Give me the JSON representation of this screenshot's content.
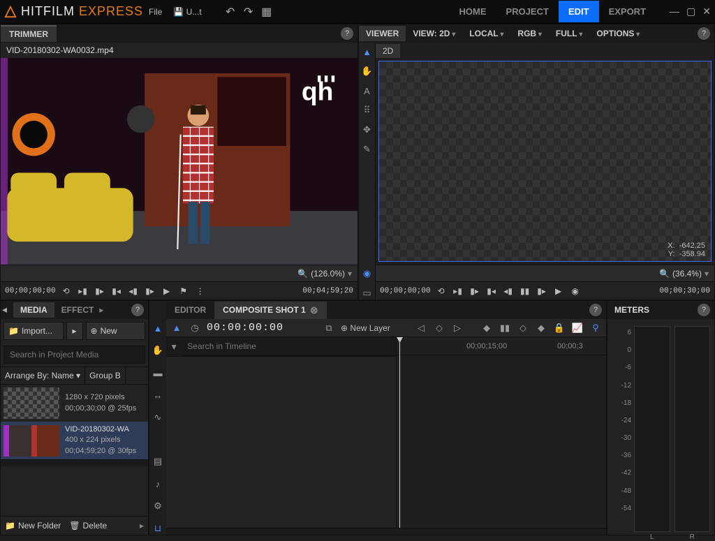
{
  "app": {
    "title_a": "HITFILM ",
    "title_b": "EXPRESS"
  },
  "menu": {
    "file": "File",
    "save": "U...t"
  },
  "nav": {
    "home": "HOME",
    "project": "PROJECT",
    "edit": "EDIT",
    "export": "EXPORT"
  },
  "trimmer": {
    "title": "TRIMMER",
    "clip": "VID-20180302-WA0032.mp4",
    "zoom": "(126.0%)",
    "tc_in": "00;00;00;00",
    "tc_out": "00;04;59;20"
  },
  "viewer": {
    "title": "VIEWER",
    "view": "VIEW: 2D",
    "space": "LOCAL",
    "channel": "RGB",
    "quality": "FULL",
    "options": "OPTIONS",
    "tab2d": "2D",
    "coord_x_label": "X:",
    "coord_x": "-642.25",
    "coord_y_label": "Y:",
    "coord_y": "-358.94",
    "zoom": "(36.4%)",
    "tc_in": "00;00;00;00",
    "tc_out": "00;00;30;00"
  },
  "media": {
    "tabs": {
      "media": "MEDIA",
      "effects": "EFFECT"
    },
    "import": "Import...",
    "new": "New",
    "search_placeholder": "Search in Project Media",
    "arrange_label": "Arrange By: Name ▾",
    "group_label": "Group B",
    "items": [
      {
        "name": "",
        "dims": "1280 x 720 pixels",
        "dur": "00;00;30;00 @ 25fps"
      },
      {
        "name": "VID-20180302-WA",
        "dims": "400 x 224 pixels",
        "dur": "00;04;59;20 @ 30fps"
      }
    ],
    "newfolder": "New Folder",
    "delete": "Delete"
  },
  "timeline": {
    "tabs": {
      "editor": "EDITOR",
      "comp": "COMPOSITE SHOT 1"
    },
    "time": "00:00:00:00",
    "newlayer": "New Layer",
    "search_placeholder": "Search in Timeline",
    "ruler_t1": "00;00;15;00",
    "ruler_t2": "00;00;3"
  },
  "meters": {
    "title": "METERS",
    "scale": [
      "6",
      "0",
      "-6",
      "-12",
      "-18",
      "-24",
      "-30",
      "-36",
      "-42",
      "-48",
      "-54",
      ""
    ],
    "left": "L",
    "right": "R"
  }
}
